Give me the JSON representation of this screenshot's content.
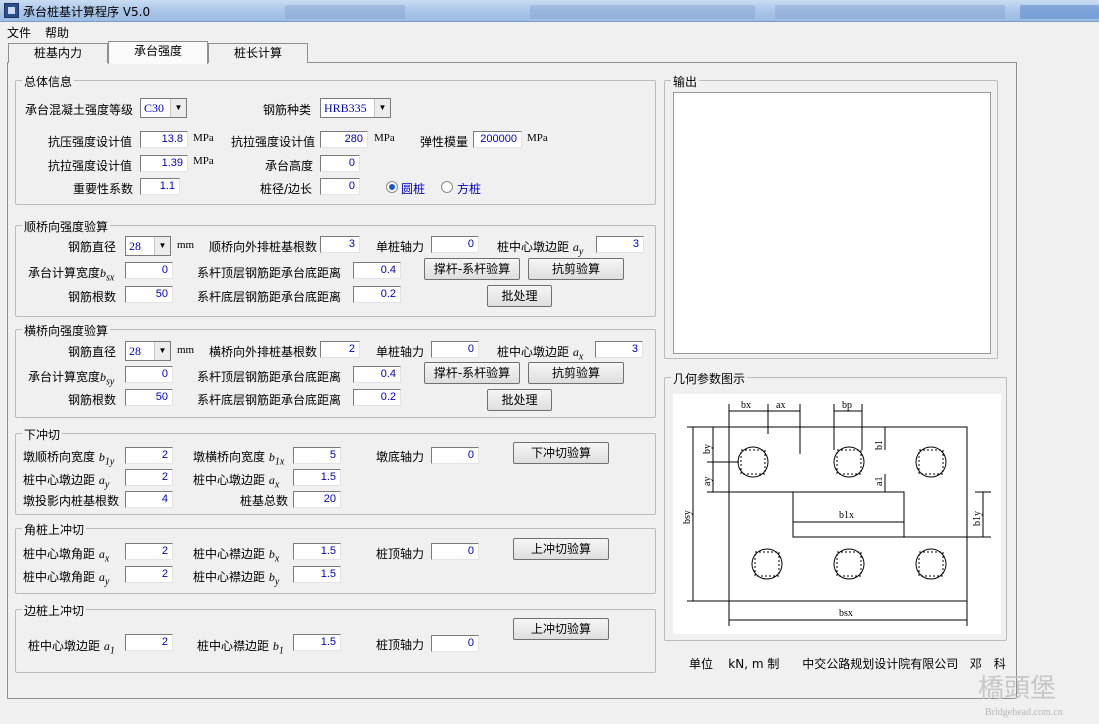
{
  "window": {
    "title": "承台桩基计算程序 V5.0"
  },
  "menu": [
    "文件",
    "帮助"
  ],
  "tabs": [
    "桩基内力",
    "承台强度",
    "桩长计算"
  ],
  "active_tab": "承台强度",
  "general": {
    "title": "总体信息",
    "concrete_grade_label": "承台混凝土强度等级",
    "concrete_grade": "C30",
    "rebar_type_label": "钢筋种类",
    "rebar_type": "HRB335",
    "compressive_label": "抗压强度设计值",
    "compressive": "13.8",
    "tensile_label": "抗拉强度设计值",
    "tensile": "1.39",
    "rebar_tensile_label": "抗拉强度设计值",
    "rebar_tensile": "280",
    "modulus_label": "弹性模量",
    "modulus": "200000",
    "unit_mpa": "MPa",
    "importance_label": "重要性系数",
    "importance": "1.1",
    "height_label": "承台高度",
    "height": "0",
    "pile_dim_label": "桩径/边长",
    "pile_dim": "0",
    "round_pile": "圆桩",
    "square_pile": "方桩"
  },
  "longitudinal": {
    "title": "顺桥向强度验算",
    "rebar_diam_label": "钢筋直径",
    "rebar_diam": "28",
    "mm": "mm",
    "outer_piles_label": "顺桥向外排桩基根数",
    "outer_piles": "3",
    "single_force_label": "单桩轴力",
    "single_force": "0",
    "center_dist_label": "桩中心墩边距",
    "center_dist_sym": "a",
    "center_dist_sub": "y",
    "center_dist": "3",
    "calc_width_label": "承台计算宽度",
    "calc_width_sym": "b",
    "calc_width_sub": "sx",
    "calc_width": "0",
    "top_rebar_label": "系杆顶层钢筋距承台底距离",
    "top_rebar": "0.4",
    "bottom_rebar_label": "系杆底层钢筋距承台底距离",
    "bottom_rebar": "0.2",
    "rebar_count_label": "钢筋根数",
    "rebar_count": "50",
    "strut_btn": "撑杆-系杆验算",
    "shear_btn": "抗剪验算",
    "batch_btn": "批处理"
  },
  "transverse": {
    "title": "横桥向强度验算",
    "rebar_diam_label": "钢筋直径",
    "rebar_diam": "28",
    "mm": "mm",
    "outer_piles_label": "横桥向外排桩基根数",
    "outer_piles": "2",
    "single_force_label": "单桩轴力",
    "single_force": "0",
    "center_dist_label": "桩中心墩边距",
    "center_dist_sym": "a",
    "center_dist_sub": "x",
    "center_dist": "3",
    "calc_width_label": "承台计算宽度",
    "calc_width_sym": "b",
    "calc_width_sub": "sy",
    "calc_width": "0",
    "top_rebar_label": "系杆顶层钢筋距承台底距离",
    "top_rebar": "0.4",
    "bottom_rebar_label": "系杆底层钢筋距承台底距离",
    "bottom_rebar": "0.2",
    "rebar_count_label": "钢筋根数",
    "rebar_count": "50",
    "strut_btn": "撑杆-系杆验算",
    "shear_btn": "抗剪验算",
    "batch_btn": "批处理"
  },
  "punch_down": {
    "title": "下冲切",
    "b1y_label": "墩顺桥向宽度",
    "b1y_sym": "b",
    "b1y_sub": "1y",
    "b1y": "2",
    "b1x_label": "墩横桥向宽度",
    "b1x_sym": "b",
    "b1x_sub": "1x",
    "b1x": "5",
    "pier_force_label": "墩底轴力",
    "pier_force": "0",
    "ay_label": "桩中心墩边距",
    "ay_sym": "a",
    "ay_sub": "y",
    "ay": "2",
    "ax_label": "桩中心墩边距",
    "ax_sym": "a",
    "ax_sub": "x",
    "ax": "1.5",
    "proj_piles_label": "墩投影内桩基根数",
    "proj_piles": "4",
    "total_piles_label": "桩基总数",
    "total_piles": "20",
    "btn": "下冲切验算"
  },
  "punch_corner": {
    "title": "角桩上冲切",
    "ax_label": "桩中心墩角距",
    "ax_sym": "a",
    "ax_sub": "x",
    "ax": "2",
    "bx_label": "桩中心襟边距",
    "bx_sym": "b",
    "bx_sub": "x",
    "bx": "1.5",
    "top_force_label": "桩顶轴力",
    "top_force": "0",
    "ay_label": "桩中心墩角距",
    "ay_sym": "a",
    "ay_sub": "y",
    "ay": "2",
    "by_label": "桩中心襟边距",
    "by_sym": "b",
    "by_sub": "y",
    "by": "1.5",
    "btn": "上冲切验算"
  },
  "punch_edge": {
    "title": "边桩上冲切",
    "a1_label": "桩中心墩边距",
    "a1_sym": "a",
    "a1_sub": "1",
    "a1": "2",
    "b1_label": "桩中心襟边距",
    "b1_sym": "b",
    "b1_sub": "1",
    "b1": "1.5",
    "top_force_label": "桩顶轴力",
    "top_force": "0",
    "btn": "上冲切验算"
  },
  "output": {
    "title": "输出"
  },
  "diagram": {
    "title": "几何参数图示",
    "labels": {
      "bx": "bx",
      "ax": "ax",
      "bp": "bp",
      "by": "by",
      "b1": "b1",
      "ay": "ay",
      "a1": "a1",
      "bsy": "bsy",
      "b1x": "b1x",
      "b1y": "b1y",
      "bsx": "bsx"
    }
  },
  "footer": {
    "unit_label": "单位",
    "unit_value": "kN, m 制",
    "org": "中交公路规划设计院有限公司",
    "author": "邓　科"
  },
  "watermark": {
    "logo": "橋頭堡",
    "url": "Bridgehead.com.cn"
  }
}
